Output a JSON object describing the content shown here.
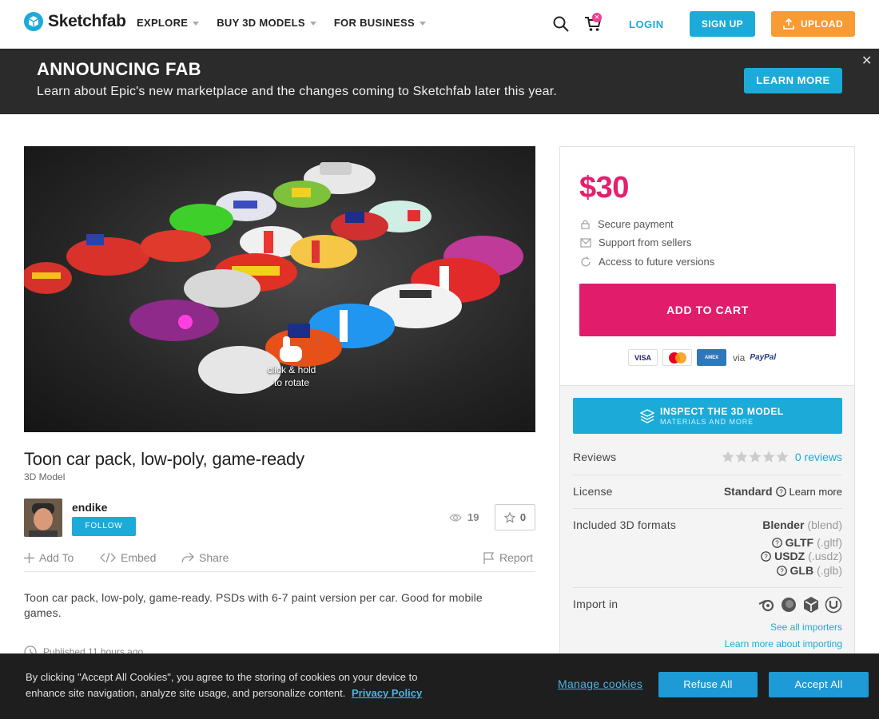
{
  "header": {
    "logo_text": "Sketchfab",
    "nav": [
      {
        "label": "EXPLORE"
      },
      {
        "label": "BUY 3D MODELS"
      },
      {
        "label": "FOR BUSINESS"
      }
    ],
    "login": "LOGIN",
    "signup": "SIGN UP",
    "upload": "UPLOAD",
    "cart_badge": "✕"
  },
  "banner": {
    "title": "ANNOUNCING FAB",
    "text": "Learn about Epic's new marketplace and the changes coming to Sketchfab later this year.",
    "button": "LEARN MORE",
    "close": "✕"
  },
  "viewer": {
    "hint_line1": "click & hold",
    "hint_line2": "to rotate"
  },
  "model": {
    "title": "Toon car pack, low-poly, game-ready",
    "type": "3D Model",
    "author": "endike",
    "follow": "FOLLOW",
    "views": "19",
    "likes": "0",
    "actions": {
      "add_to": "Add To",
      "embed": "Embed",
      "share": "Share",
      "report": "Report"
    },
    "description": "Toon car pack, low-poly, game-ready. PSDs with 6-7 paint version per car. Good for mobile games.",
    "published": "Published 11 hours ago"
  },
  "purchase": {
    "price": "$30",
    "perks": [
      "Secure payment",
      "Support from sellers",
      "Access to future versions"
    ],
    "add_to_cart": "ADD TO CART",
    "via": "via",
    "paypal": "PayPal",
    "cards": [
      "VISA",
      "MasterCard",
      "AMEX"
    ]
  },
  "info": {
    "inspect_title": "INSPECT THE 3D MODEL",
    "inspect_sub": "MATERIALS AND MORE",
    "reviews_label": "Reviews",
    "reviews_value": "0 reviews",
    "license_label": "License",
    "license_value": "Standard",
    "license_link": "Learn more",
    "formats_label": "Included 3D formats",
    "formats": [
      {
        "name": "Blender",
        "ext": "(blend)"
      },
      {
        "name": "GLTF",
        "ext": "(.gltf)"
      },
      {
        "name": "USDZ",
        "ext": "(.usdz)"
      },
      {
        "name": "GLB",
        "ext": "(.glb)"
      }
    ],
    "import_label": "Import in",
    "importers": [
      "blender-icon",
      "cinema4d-icon",
      "unity-icon",
      "unreal-icon"
    ],
    "see_importers": "See all importers",
    "learn_importing": "Learn more about importing"
  },
  "cookie": {
    "text": "By clicking \"Accept All Cookies\", you agree to the storing of cookies on your device to enhance site navigation, analyze site usage, and personalize content.",
    "policy": "Privacy Policy",
    "manage": "Manage cookies",
    "refuse": "Refuse All",
    "accept": "Accept All"
  },
  "colors": {
    "brand": "#1caad9",
    "price": "#e61e6e",
    "cart_button": "#e01c6b",
    "upload": "#f89b35",
    "banner_bg": "#2b2b2b",
    "cookie_bg": "#1e1e1e"
  }
}
